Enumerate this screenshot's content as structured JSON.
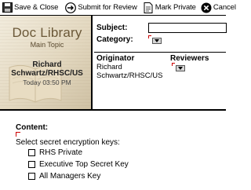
{
  "toolbar": {
    "save_close": "Save & Close",
    "submit_review": "Submit for Review",
    "mark_private": "Mark Private",
    "cancel": "Cancel"
  },
  "banner": {
    "title": "Doc Library",
    "subtitle": "Main Topic",
    "author": "Richard Schwartz/RHSC/US",
    "date": "Today 03:50 PM"
  },
  "form": {
    "subject_label": "Subject:",
    "subject_value": "",
    "category_label": "Category:",
    "originator_label": "Originator",
    "reviewers_label": "Reviewers",
    "originator_value": "Richard Schwartz/RHSC/US"
  },
  "content": {
    "label": "Content:",
    "encryption_label": "Select secret encryption keys:",
    "keys": [
      "RHS Private",
      "Executive Top Secret Key",
      "All Managers Key"
    ]
  }
}
